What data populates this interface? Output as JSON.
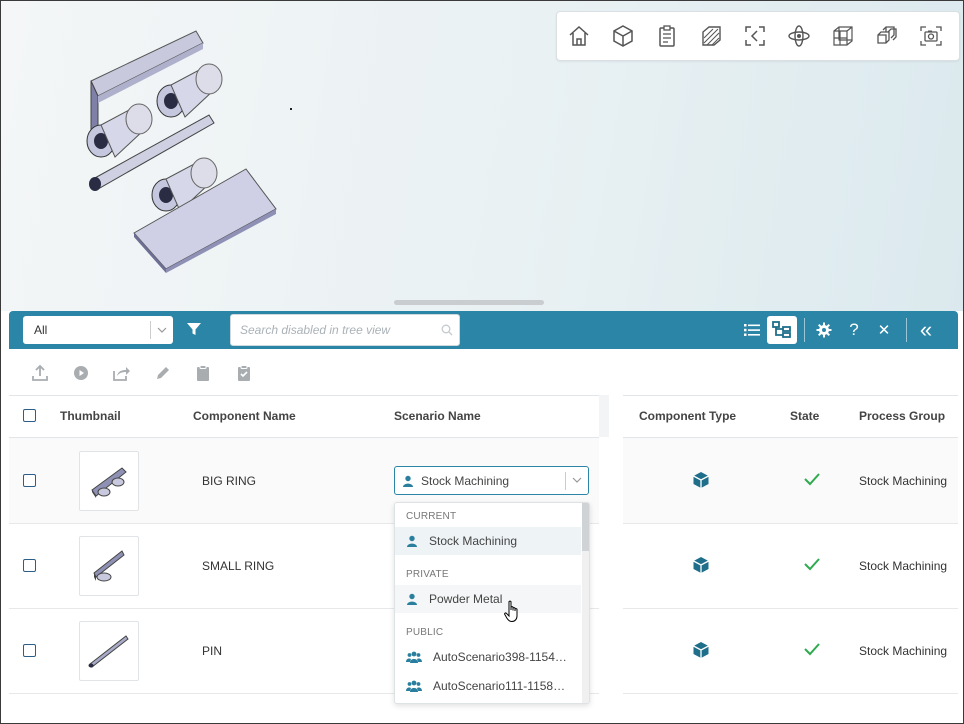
{
  "viewer": {
    "toolbar_icons": [
      "home-icon",
      "cube-view-icon",
      "clipboard-icon",
      "section-cut-icon",
      "fit-view-icon",
      "orbit-icon",
      "wireframe-icon",
      "explode-icon",
      "screenshot-camera-icon"
    ]
  },
  "header": {
    "filter_value": "All",
    "search_placeholder": "Search disabled in tree view",
    "icons": [
      "list-view-icon",
      "tree-view-icon",
      "settings-icon",
      "help-icon",
      "close-icon",
      "collapse-icon"
    ],
    "help_glyph": "?",
    "close_glyph": "✕",
    "collapse_glyph": "«"
  },
  "actions": [
    "upload-icon",
    "play-icon",
    "share-icon",
    "edit-icon",
    "clipboard-icon",
    "clipboard-check-icon"
  ],
  "table": {
    "columns": {
      "thumbnail": "Thumbnail",
      "component_name": "Component Name",
      "scenario_name": "Scenario Name",
      "component_type": "Component Type",
      "state": "State",
      "process_group": "Process Group"
    },
    "rows": [
      {
        "name": "BIG RING",
        "scenario": "Stock Machining",
        "process_group": "Stock Machining"
      },
      {
        "name": "SMALL RING",
        "scenario": "",
        "process_group": "Stock Machining"
      },
      {
        "name": "PIN",
        "scenario": "",
        "process_group": "Stock Machining"
      }
    ]
  },
  "scenario_dropdown": {
    "selected": "Stock Machining",
    "groups": [
      {
        "label": "CURRENT",
        "items": [
          "Stock Machining"
        ]
      },
      {
        "label": "PRIVATE",
        "items": [
          "Powder Metal"
        ]
      },
      {
        "label": "PUBLIC",
        "items": [
          "AutoScenario398-1154…",
          "AutoScenario111-1158…"
        ]
      }
    ]
  },
  "colors": {
    "header": "#2b85a6",
    "accent_icon": "#1f6f8b",
    "check": "#2eaa4f"
  }
}
